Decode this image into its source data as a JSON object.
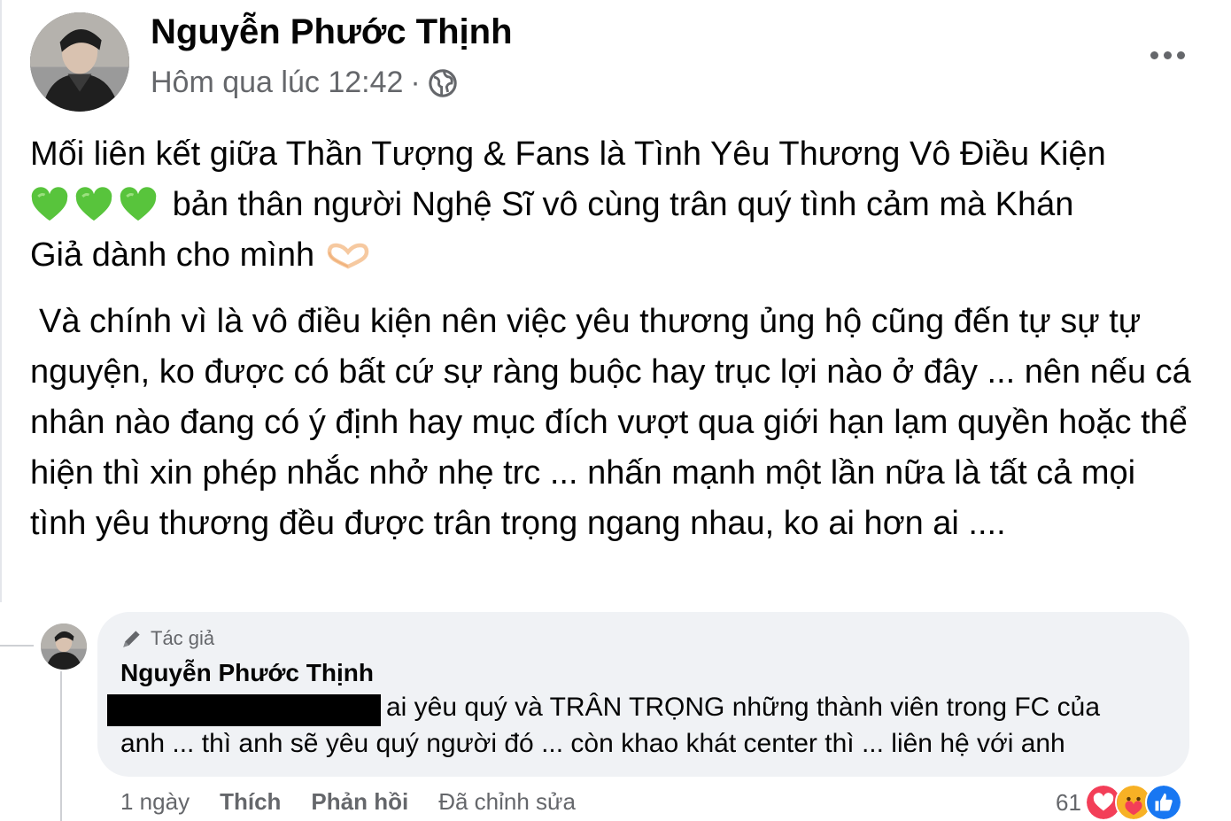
{
  "post": {
    "author": "Nguyễn Phước Thịnh",
    "timestamp": "Hôm qua lúc 12:42",
    "separator": "·",
    "paragraph1_line1": "Mối liên kết giữa Thần Tượng & Fans là Tình Yêu Thương Vô Điều Kiện",
    "paragraph1_line2": "bản thân người Nghệ Sĩ vô cùng trân quý tình cảm mà Khán",
    "paragraph1_line3": "Giả dành cho mình",
    "paragraph2": "Và chính vì là vô điều kiện nên việc yêu thương ủng hộ cũng đến tự sự tự nguyện, ko được có bất cứ sự ràng buộc hay trục lợi nào ở đây ... nên nếu cá nhân nào đang có ý định hay mục đích vượt qua giới hạn lạm quyền hoặc thể hiện thì xin phép nhắc nhở nhẹ trc ... nhấn mạnh một lần nữa là tất cả mọi tình yêu thương đều được trân trọng ngang nhau, ko ai hơn ai ....",
    "icons": {
      "privacy": "globe-icon",
      "more": "more-options-icon",
      "emoji_hearts": "green-heart-icon",
      "emoji_hands": "heart-hands-icon"
    },
    "colors": {
      "green_heart": "#58c43c",
      "secondary_text": "#65676b"
    }
  },
  "comment": {
    "badge": "Tác giả",
    "badge_icon": "pen-icon",
    "author": "Nguyễn Phước Thịnh",
    "line1": "ai yêu quý và TRÂN TRỌNG những thành viên trong FC của",
    "line2": "anh ... thì anh sẽ yêu quý người đó ... còn khao khát center thì ... liên hệ với anh",
    "actions": {
      "time": "1 ngày",
      "like": "Thích",
      "reply": "Phản hồi",
      "edited": "Đã chỉnh sửa"
    },
    "reaction_count": "61",
    "reaction_icons": [
      "love-icon",
      "care-icon",
      "like-icon"
    ],
    "colors": {
      "bubble": "#f0f2f5",
      "love": "#f33e58",
      "like": "#1877f2",
      "care": "#f7b125"
    }
  }
}
